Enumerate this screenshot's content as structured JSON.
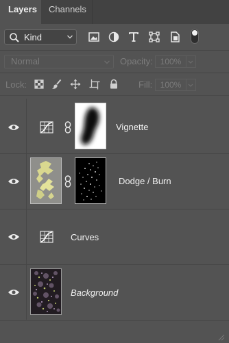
{
  "tabs": {
    "layers": "Layers",
    "channels": "Channels"
  },
  "filter": {
    "kind_label": "Kind",
    "icons": [
      "search-icon",
      "chevron-down-icon",
      "image-filter-icon",
      "adjustment-filter-icon",
      "type-filter-icon",
      "shape-filter-icon",
      "smart-object-filter-icon",
      "filter-toggle-switch"
    ]
  },
  "blend": {
    "mode": "Normal",
    "opacity_label": "Opacity:",
    "opacity_value": "100%"
  },
  "lock": {
    "label": "Lock:",
    "fill_label": "Fill:",
    "fill_value": "100%",
    "icons": [
      "lock-transparent-pixels-icon",
      "lock-image-pixels-icon",
      "lock-position-icon",
      "lock-artboard-icon",
      "lock-all-icon"
    ]
  },
  "layers": [
    {
      "name": "Vignette",
      "type": "curves-adjustment",
      "visible": true,
      "has_mask": true
    },
    {
      "name": "Dodge / Burn",
      "type": "pixel",
      "visible": true,
      "has_mask": true
    },
    {
      "name": "Curves",
      "type": "curves-adjustment",
      "visible": true,
      "has_mask": false
    },
    {
      "name": "Background",
      "type": "background",
      "visible": true,
      "italic": true
    }
  ],
  "colors": {
    "panel_bg": "#535353",
    "tab_bar_bg": "#424242",
    "text": "#f2f2f2",
    "disabled_text": "#7d7d7d"
  }
}
